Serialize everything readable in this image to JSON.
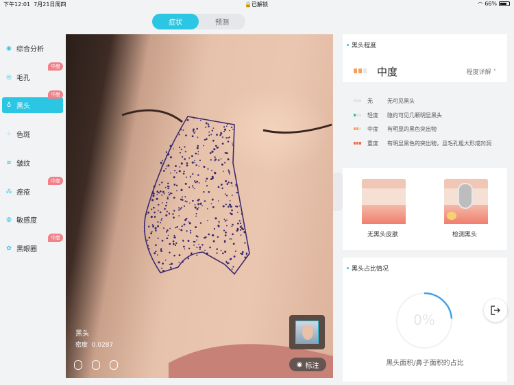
{
  "status_bar": {
    "time": "下午12:01",
    "date": "7月21日周四",
    "lock": "已解锁",
    "battery": "66%"
  },
  "tabs": [
    {
      "label": "症状",
      "active": true
    },
    {
      "label": "预测",
      "active": false
    }
  ],
  "sidebar": {
    "items": [
      {
        "label": "综合分析",
        "icon": "overview-icon",
        "badge": ""
      },
      {
        "label": "毛孔",
        "icon": "pore-icon",
        "badge": "中度"
      },
      {
        "label": "黑头",
        "icon": "blackhead-icon",
        "badge": "中度",
        "active": true
      },
      {
        "label": "色斑",
        "icon": "spot-icon",
        "badge": ""
      },
      {
        "label": "皱纹",
        "icon": "wrinkle-icon",
        "badge": ""
      },
      {
        "label": "痤疮",
        "icon": "acne-icon",
        "badge": "中度"
      },
      {
        "label": "敏感度",
        "icon": "sensitivity-icon",
        "badge": ""
      },
      {
        "label": "黑眼圈",
        "icon": "dark-circle-icon",
        "badge": "中度"
      }
    ]
  },
  "photo": {
    "caption_title": "黑头",
    "density_label": "密度",
    "density_value": "0.0287",
    "mark_label": "标注"
  },
  "severity_card": {
    "title": "黑头程度",
    "level": "中度",
    "detail_label": "程度详解",
    "level_index": 3
  },
  "legend": [
    {
      "name": "无",
      "desc": "无可见黑头"
    },
    {
      "name": "轻度",
      "desc": "隐约可见几颗明显黑头"
    },
    {
      "name": "中度",
      "desc": "有明显的黑色突出物"
    },
    {
      "name": "重度",
      "desc": "有明显黑色的突出物，且毛孔粗大形成凹洞"
    }
  ],
  "illustrations": [
    {
      "label": "无黑头皮肤"
    },
    {
      "label": "检测黑头"
    }
  ],
  "ratio_card": {
    "title": "黑头占比情况",
    "percent": "0%",
    "caption": "黑头面积/鼻子面积的占比"
  },
  "colors": {
    "accent": "#2bc6e3",
    "badge": "#f0808a",
    "moderate": "#f5a15a",
    "severe": "#ef6b4f",
    "mild": "#37c37a"
  }
}
